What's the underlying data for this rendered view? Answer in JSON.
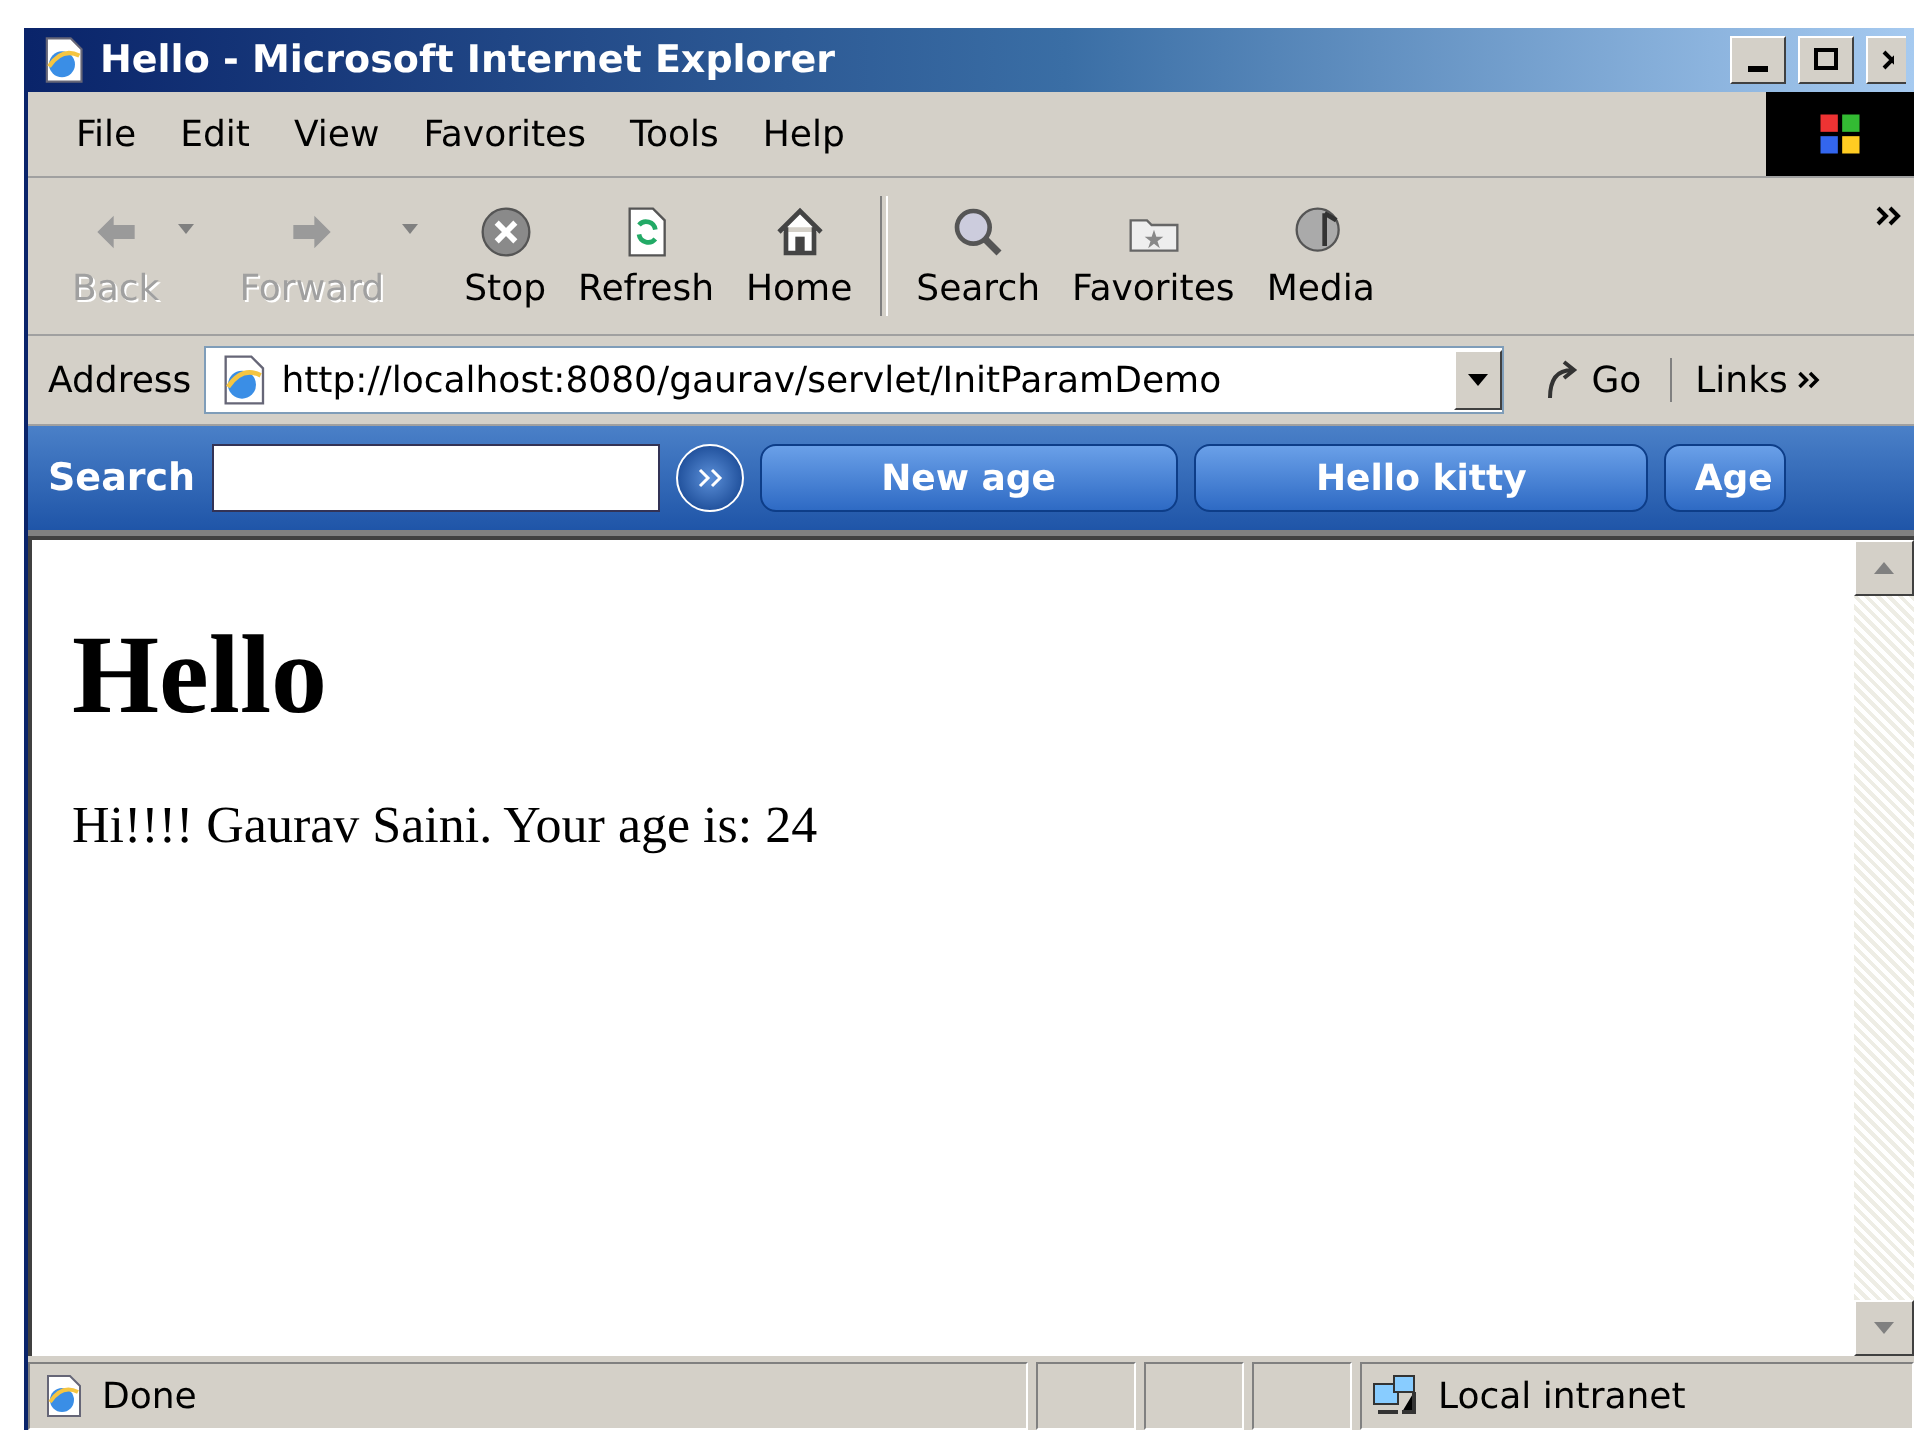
{
  "window": {
    "title": "Hello - Microsoft Internet Explorer"
  },
  "menu": [
    "File",
    "Edit",
    "View",
    "Favorites",
    "Tools",
    "Help"
  ],
  "toolbar": [
    {
      "label": "Back",
      "kind": "back",
      "disabled": true,
      "dropdown": true
    },
    {
      "label": "Forward",
      "kind": "forward",
      "disabled": true,
      "dropdown": true
    },
    {
      "label": "Stop",
      "kind": "stop",
      "disabled": false,
      "dropdown": false
    },
    {
      "label": "Refresh",
      "kind": "refresh",
      "disabled": false,
      "dropdown": false
    },
    {
      "label": "Home",
      "kind": "home",
      "disabled": false,
      "dropdown": false
    },
    {
      "label": "Search",
      "kind": "search",
      "disabled": false,
      "dropdown": false
    },
    {
      "label": "Favorites",
      "kind": "favorites",
      "disabled": false,
      "dropdown": false
    },
    {
      "label": "Media",
      "kind": "media",
      "disabled": false,
      "dropdown": false
    }
  ],
  "address": {
    "label": "Address",
    "value": "http://localhost:8080/gaurav/servlet/InitParamDemo",
    "go": "Go",
    "links": "Links"
  },
  "search_bar": {
    "label": "Search",
    "buttons": [
      "New age",
      "Hello kitty",
      "Age"
    ]
  },
  "page": {
    "heading": "Hello",
    "text": "Hi!!!! Gaurav Saini. Your age is: 24"
  },
  "status_bar": {
    "text": "Done",
    "zone": "Local intranet"
  }
}
